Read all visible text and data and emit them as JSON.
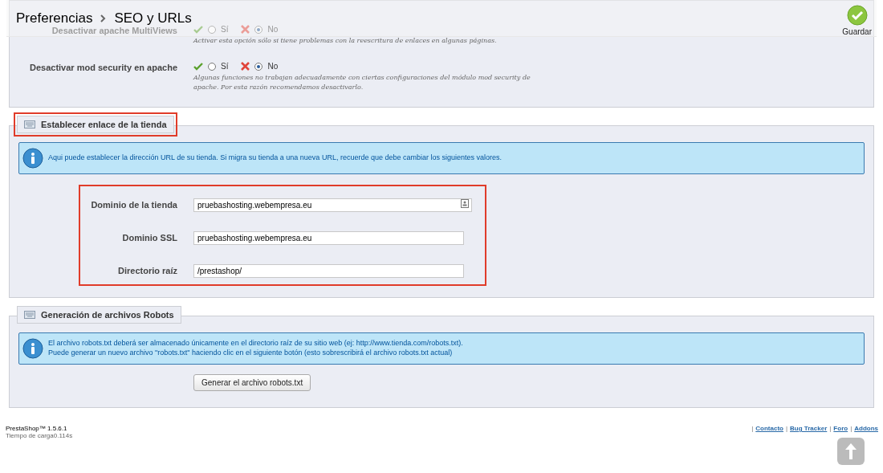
{
  "header": {
    "breadcrumb": [
      "Preferencias",
      "SEO y URLs"
    ],
    "save_button": "Guardar"
  },
  "sections": [
    {
      "kind": "options",
      "rows": [
        {
          "label": "Desactivar apache MultiViews",
          "options": [
            {
              "label": "Sí",
              "selected": false
            },
            {
              "label": "No",
              "selected": true
            }
          ],
          "help": "Activar esta opción sólo si tiene problemas con la reescritura de enlaces en algunas páginas."
        },
        {
          "label": "Desactivar mod security en apache",
          "options": [
            {
              "label": "Sí",
              "selected": false
            },
            {
              "label": "No",
              "selected": true
            }
          ],
          "help": "Algunas funciones no trabajan adecuadamente con ciertas configuraciones del módulo mod security de apache. Por esta razón recomendamos desactivarlo."
        }
      ]
    },
    {
      "kind": "fields",
      "legend": "Establecer enlace de la tienda",
      "highlighted": true,
      "info": [
        "Aqui puede establecer la dirección URL de su tienda. Si migra su tienda a una nueva URL, recuerde que debe cambiar los siguientes valores."
      ],
      "fields_highlighted": true,
      "fields": [
        {
          "label": "Dominio de la tienda",
          "value": "pruebashosting.webempresa.eu",
          "kind": "autofill"
        },
        {
          "label": "Dominio SSL",
          "value": "pruebashosting.webempresa.eu",
          "kind": "plain"
        },
        {
          "label": "Directorio raíz",
          "value": "/prestashop/",
          "kind": "plain"
        }
      ]
    },
    {
      "kind": "action",
      "legend": "Generación de archivos Robots",
      "highlighted": false,
      "info": [
        "El archivo robots.txt deberá ser almacenado únicamente en el directorio raíz de su sitio web (ej: http://www.tienda.com/robots.txt).",
        "Puede generar un nuevo archivo \"robots.txt\" haciendo clic en el siguiente botón (esto sobrescribirá el archivo robots.txt actual)"
      ],
      "button": "Generar el archivo robots.txt"
    }
  ],
  "footer": {
    "version": "PrestaShop™ 1.5.6.1",
    "load_time": "Tiempo de carga0.114s",
    "separator": "|",
    "links": [
      "Contacto",
      "Bug Tracker",
      "Foro",
      "Addons"
    ]
  }
}
